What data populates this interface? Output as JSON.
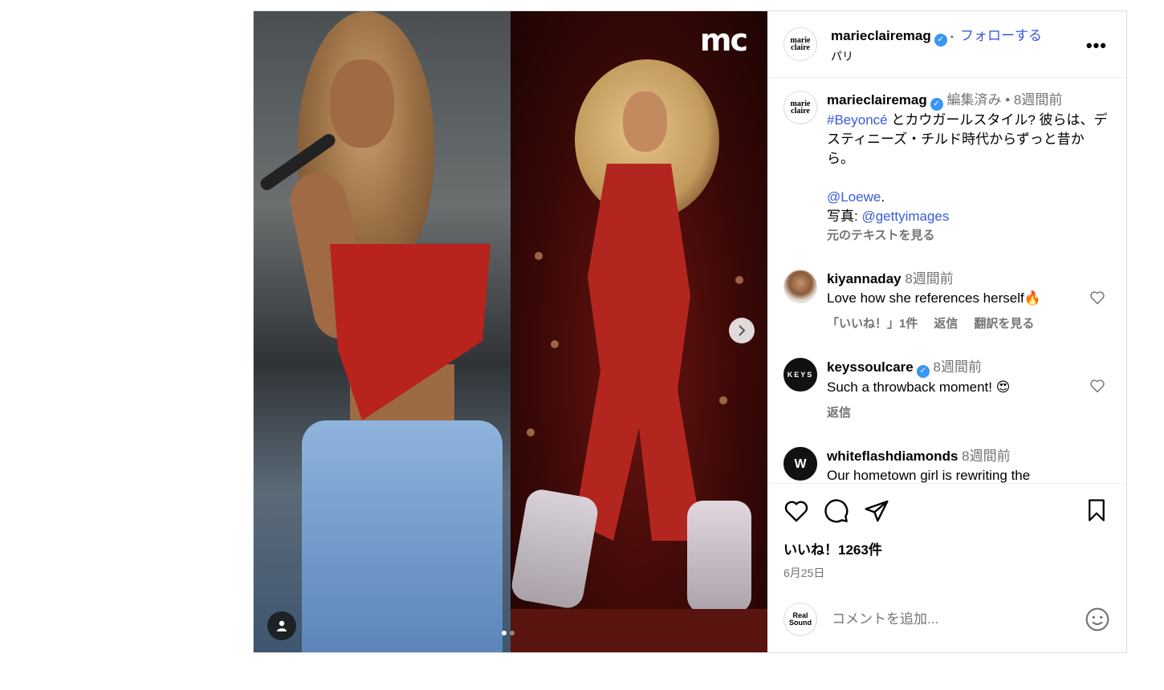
{
  "media": {
    "logo_text": "mc",
    "carousel": {
      "count": 2,
      "active": 1
    }
  },
  "header": {
    "avatar_text": "marie claire",
    "username": "marieclairemag",
    "separator": "•",
    "follow_label": "フォローする",
    "location": "パリ",
    "more_label": "•••"
  },
  "caption": {
    "avatar_text": "marie claire",
    "username": "marieclairemag",
    "edited": "編集済み •",
    "time": "8週間前",
    "hashtag": "#Beyoncé",
    "text1": " とカウガールスタイル? 彼らは、デスティニーズ・チルド時代からずっと昔から。",
    "mention_loewe": "@Loewe",
    "period": ".",
    "photo_label": "写真: ",
    "mention_getty": "@gettyimages",
    "see_original": "元のテキストを見る"
  },
  "comments": [
    {
      "username": "kiyannaday",
      "time": "8週間前",
      "text": "Love how she references herself🔥",
      "likes": "「いいね！」1件",
      "reply": "返信",
      "translate": "翻訳を見る"
    },
    {
      "username": "keyssoulcare",
      "avatar_text": "KEYS",
      "time": "8週間前",
      "text": "Such a throwback moment! 😍",
      "reply": "返信"
    },
    {
      "username": "whiteflashdiamonds",
      "avatar_text": "W",
      "time": "8週間前",
      "text": "Our hometown girl is rewriting the"
    }
  ],
  "footer": {
    "likes": "いいね！1263件",
    "date": "6月25日",
    "commenter_avatar_text": "Real Sound",
    "add_comment_placeholder": "コメントを追加..."
  },
  "colors": {
    "link": "#385bd8",
    "verified": "#3897f0",
    "muted": "#737373"
  }
}
